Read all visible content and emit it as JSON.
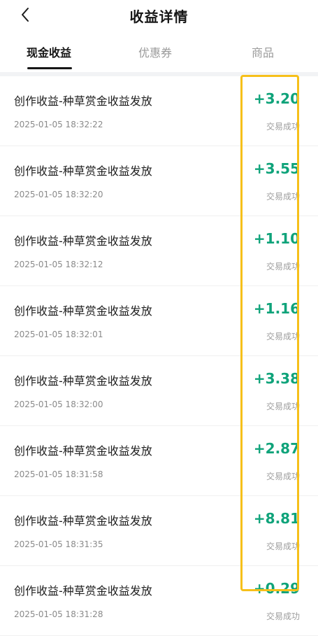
{
  "header": {
    "title": "收益详情",
    "back_icon": "chevron-left-icon"
  },
  "tabs": [
    {
      "label": "现金收益",
      "active": true
    },
    {
      "label": "优惠券",
      "active": false
    },
    {
      "label": "商品",
      "active": false
    }
  ],
  "records": [
    {
      "title": "创作收益-种草赏金收益发放",
      "time": "2025-01-05 18:32:22",
      "amount": "+3.20",
      "status": "交易成功"
    },
    {
      "title": "创作收益-种草赏金收益发放",
      "time": "2025-01-05 18:32:20",
      "amount": "+3.55",
      "status": "交易成功"
    },
    {
      "title": "创作收益-种草赏金收益发放",
      "time": "2025-01-05 18:32:12",
      "amount": "+1.10",
      "status": "交易成功"
    },
    {
      "title": "创作收益-种草赏金收益发放",
      "time": "2025-01-05 18:32:01",
      "amount": "+1.16",
      "status": "交易成功"
    },
    {
      "title": "创作收益-种草赏金收益发放",
      "time": "2025-01-05 18:32:00",
      "amount": "+3.38",
      "status": "交易成功"
    },
    {
      "title": "创作收益-种草赏金收益发放",
      "time": "2025-01-05 18:31:58",
      "amount": "+2.87",
      "status": "交易成功"
    },
    {
      "title": "创作收益-种草赏金收益发放",
      "time": "2025-01-05 18:31:35",
      "amount": "+8.81",
      "status": "交易成功"
    },
    {
      "title": "创作收益-种草赏金收益发放",
      "time": "2025-01-05 18:31:28",
      "amount": "+0.29",
      "status": "交易成功"
    }
  ],
  "colors": {
    "amount": "#0fa37a",
    "highlight": "#f6c01a"
  }
}
